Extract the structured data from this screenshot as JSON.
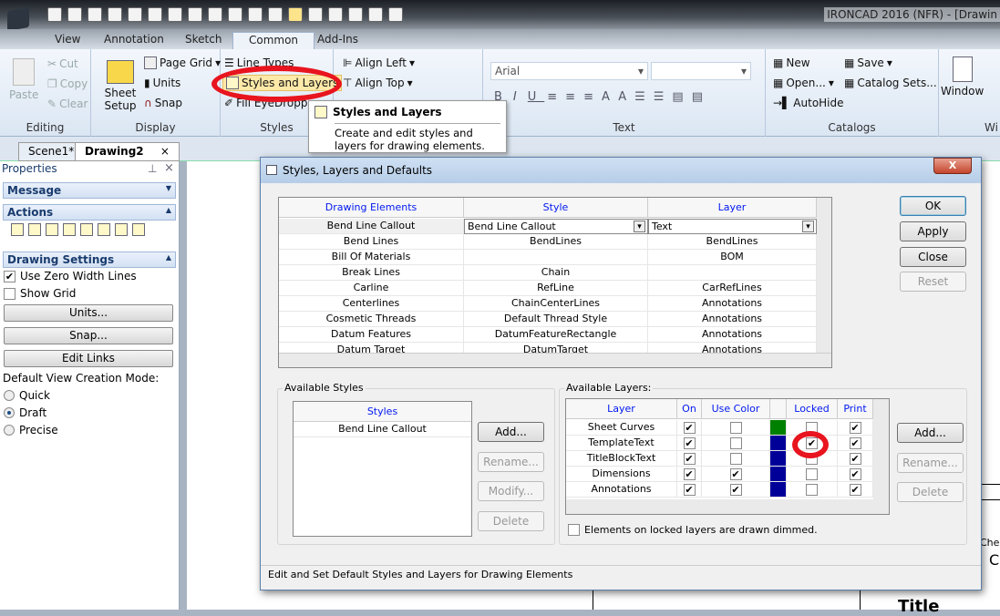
{
  "app": {
    "title": "IRONCAD 2016 (NFR) - [Drawin"
  },
  "quick_access": [
    "new-icon",
    "open-red-icon",
    "import-icon",
    "sheet-icon",
    "sheet2-icon",
    "folder-open-icon",
    "save-icon",
    "edit-icon",
    "print-icon",
    "preview-icon",
    "undo-icon",
    "redo-icon",
    "tree-icon",
    "styles-icon",
    "sheet-setup-icon",
    "units-icon",
    "list-icon",
    "window-icon"
  ],
  "ribbon_tabs": [
    {
      "label": "View"
    },
    {
      "label": "Annotation"
    },
    {
      "label": "Sketch"
    },
    {
      "label": "Common",
      "active": true
    },
    {
      "label": "Add-Ins"
    }
  ],
  "ribbon": {
    "editing": {
      "label": "Editing",
      "paste": "Paste",
      "cut": "Cut",
      "copy": "Copy",
      "clear": "Clear"
    },
    "display": {
      "label": "Display",
      "sheet_setup": "Sheet Setup",
      "page_grid": "Page Grid",
      "units": "Units",
      "snap": "Snap"
    },
    "styles": {
      "label": "Styles",
      "line_types": "Line Types",
      "styles_layers": "Styles and Layers",
      "fill_eyedropper": "Fill EyeDropp"
    },
    "align": {
      "align_left": "Align Left",
      "align_top": "Align Top"
    },
    "text": {
      "label": "Text",
      "font": "Arial",
      "size": ""
    },
    "catalogs": {
      "label": "Catalogs",
      "new": "New",
      "save": "Save",
      "open": "Open...",
      "catalog_sets": "Catalog Sets...",
      "autohide": "AutoHide"
    },
    "window": {
      "label": "Window",
      "group": "Wi"
    }
  },
  "tooltip": {
    "title": "Styles and Layers",
    "body": "Create and edit styles and layers for drawing elements."
  },
  "doc_tabs": [
    {
      "label": "Scene1*"
    },
    {
      "label": "Drawing2",
      "active": true
    }
  ],
  "properties": {
    "title": "Properties",
    "message": "Message",
    "actions": "Actions",
    "drawing_settings": "Drawing Settings",
    "use_zero_width": {
      "label": "Use Zero Width Lines",
      "checked": true
    },
    "show_grid": {
      "label": "Show Grid",
      "checked": false
    },
    "units_btn": "Units...",
    "snap_btn": "Snap...",
    "edit_links_btn": "Edit Links",
    "mode_label": "Default View Creation Mode:",
    "modes": [
      {
        "label": "Quick",
        "selected": false
      },
      {
        "label": "Draft",
        "selected": true
      },
      {
        "label": "Precise",
        "selected": false
      }
    ]
  },
  "dialog": {
    "title": "Styles, Layers and Defaults",
    "close": "X",
    "elements_table": {
      "headers": [
        "Drawing Elements",
        "Style",
        "Layer"
      ],
      "rows": [
        [
          "Bend Line Callout",
          "Bend Line Callout",
          "Text"
        ],
        [
          "Bend Lines",
          "BendLines",
          "BendLines"
        ],
        [
          "Bill Of Materials",
          "",
          "BOM"
        ],
        [
          "Break Lines",
          "Chain",
          ""
        ],
        [
          "Carline",
          "RefLine",
          "CarRefLines"
        ],
        [
          "Centerlines",
          "ChainCenterLines",
          "Annotations"
        ],
        [
          "Cosmetic Threads",
          "Default Thread Style",
          "Annotations"
        ],
        [
          "Datum Features",
          "DatumFeatureRectangle",
          "Annotations"
        ],
        [
          "Datum Target",
          "DatumTarget",
          "Annotations"
        ]
      ]
    },
    "buttons": {
      "ok": "OK",
      "apply": "Apply",
      "close": "Close",
      "reset": "Reset"
    },
    "available_styles": {
      "label": "Available Styles",
      "header": "Styles",
      "items": [
        "Bend Line Callout"
      ],
      "add": "Add...",
      "rename": "Rename...",
      "modify": "Modify...",
      "delete": "Delete"
    },
    "available_layers": {
      "label": "Available Layers:",
      "headers": [
        "Layer",
        "On",
        "Use Color",
        "",
        "Locked",
        "Print"
      ],
      "rows": [
        {
          "name": "Sheet Curves",
          "on": true,
          "use_color": false,
          "color": "#008000",
          "locked": false,
          "print": true
        },
        {
          "name": "TemplateText",
          "on": true,
          "use_color": false,
          "color": "#000099",
          "locked": true,
          "print": true
        },
        {
          "name": "TitleBlockText",
          "on": true,
          "use_color": false,
          "color": "#000099",
          "locked": false,
          "print": true
        },
        {
          "name": "Dimensions",
          "on": true,
          "use_color": true,
          "color": "#000099",
          "locked": false,
          "print": true
        },
        {
          "name": "Annotations",
          "on": true,
          "use_color": true,
          "color": "#000099",
          "locked": false,
          "print": true
        }
      ],
      "add": "Add...",
      "rename": "Rename...",
      "delete": "Delete",
      "dimmed": {
        "label": "Elements on locked layers are drawn dimmed.",
        "checked": false
      }
    },
    "status": "Edit and Set Default Styles and Layers for Drawing Elements"
  },
  "sheet": {
    "title_fragment": "Title",
    "che": "Che",
    "c": "C"
  },
  "colors": {
    "highlight": "#e8141e",
    "header_text": "#0018f0"
  }
}
